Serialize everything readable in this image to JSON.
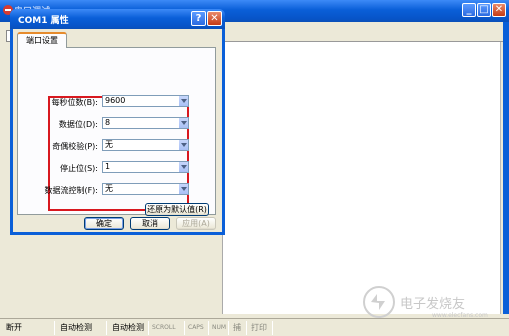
{
  "main_window": {
    "title": "串口调试",
    "buttons": {
      "minimize": "_",
      "maximize": "□",
      "close": "✕"
    }
  },
  "dialog": {
    "title": "COM1 属性",
    "help_glyph": "?",
    "close_glyph": "✕",
    "tab": "端口设置",
    "fields": [
      {
        "label": "每秒位数(B):",
        "value": "9600"
      },
      {
        "label": "数据位(D):",
        "value": "8"
      },
      {
        "label": "奇偶校验(P):",
        "value": "无"
      },
      {
        "label": "停止位(S):",
        "value": "1"
      },
      {
        "label": "数据流控制(F):",
        "value": "无"
      }
    ],
    "restore_defaults": "还原为默认值(R)",
    "ok": "确定",
    "cancel": "取消",
    "apply": "应用(A)",
    "highlight_color": "#d8181f"
  },
  "status_bar": {
    "cells": [
      "断开",
      "自动检测",
      "自动检测",
      "SCROLL",
      "CAPS",
      "NUM",
      "捕",
      "打印"
    ]
  },
  "watermark": {
    "text": "电子发烧友",
    "url": "www.elecfans.com"
  },
  "colors": {
    "titlebar": "#0a5fd8",
    "face": "#ece9d8",
    "highlight": "#d8181f"
  }
}
